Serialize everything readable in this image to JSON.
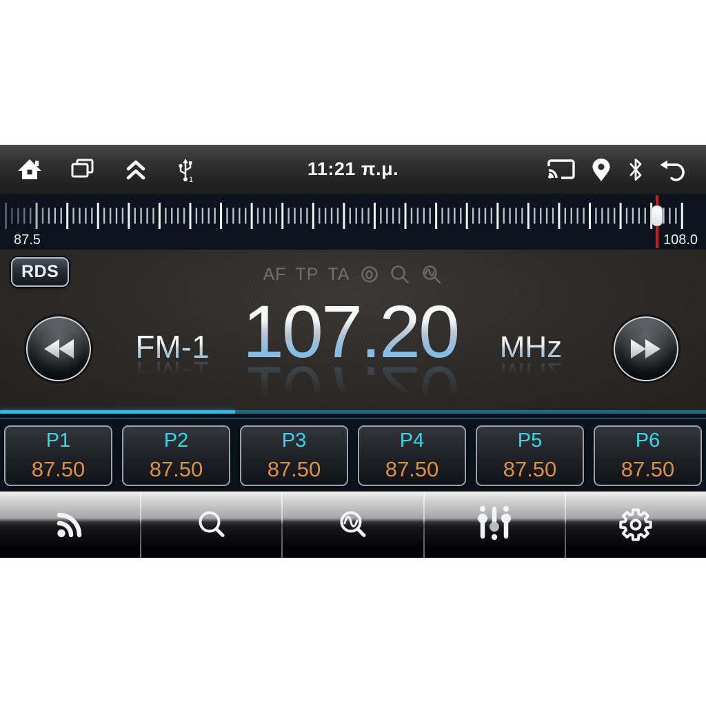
{
  "status_bar": {
    "time": "11:21 π.μ.",
    "usb_badge": "1",
    "left_icons": [
      "home-icon",
      "recent-apps-icon",
      "collapse-up-icon",
      "usb-icon"
    ],
    "right_icons": [
      "cast-icon",
      "location-icon",
      "bluetooth-icon",
      "back-icon"
    ]
  },
  "tuner_scale": {
    "min_label": "87.5",
    "max_label": "108.0",
    "pointer_position_pct": 93.1
  },
  "radio": {
    "rds_label": "RDS",
    "flags": [
      "AF",
      "TP",
      "TA"
    ],
    "status_icons": [
      "loop-icon",
      "search-icon",
      "scan-icon"
    ],
    "band": "FM-1",
    "frequency": "107.20",
    "unit": "MHz"
  },
  "presets": [
    {
      "label": "P1",
      "frequency": "87.50"
    },
    {
      "label": "P2",
      "frequency": "87.50"
    },
    {
      "label": "P3",
      "frequency": "87.50"
    },
    {
      "label": "P4",
      "frequency": "87.50"
    },
    {
      "label": "P5",
      "frequency": "87.50"
    },
    {
      "label": "P6",
      "frequency": "87.50"
    }
  ],
  "toolbar": {
    "items": [
      {
        "icon": "radio-waves-icon"
      },
      {
        "icon": "search-icon"
      },
      {
        "icon": "scan-icon"
      },
      {
        "icon": "equalizer-icon"
      },
      {
        "icon": "settings-gear-icon"
      }
    ]
  },
  "colors": {
    "accent_cyan": "#12cbe4",
    "teal_dim": "#156d7d",
    "preset_label": "#30d9ec",
    "preset_value": "#dd9140",
    "pointer_red": "#c41e1e"
  }
}
